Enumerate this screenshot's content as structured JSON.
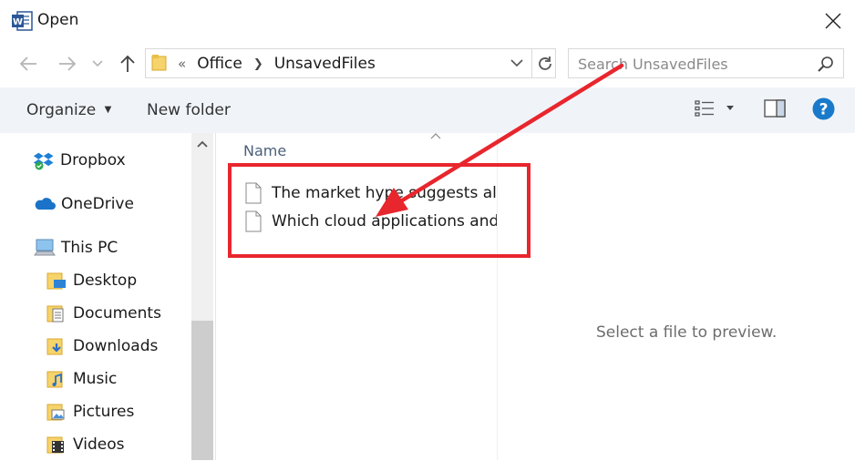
{
  "window": {
    "title": "Open"
  },
  "address": {
    "crumb_prefix": "«",
    "crumbs": [
      "Office",
      "UnsavedFiles"
    ]
  },
  "search": {
    "placeholder": "Search UnsavedFiles"
  },
  "toolbar": {
    "organize_label": "Organize",
    "new_folder_label": "New folder"
  },
  "sidebar": {
    "items": [
      {
        "label": "Dropbox",
        "icon": "dropbox-icon"
      },
      {
        "label": "OneDrive",
        "icon": "onedrive-icon"
      },
      {
        "label": "This PC",
        "icon": "computer-icon"
      },
      {
        "label": "Desktop",
        "icon": "desktop-folder-icon"
      },
      {
        "label": "Documents",
        "icon": "documents-folder-icon"
      },
      {
        "label": "Downloads",
        "icon": "downloads-folder-icon"
      },
      {
        "label": "Music",
        "icon": "music-folder-icon"
      },
      {
        "label": "Pictures",
        "icon": "pictures-folder-icon"
      },
      {
        "label": "Videos",
        "icon": "videos-folder-icon"
      }
    ]
  },
  "filelist": {
    "column_header": "Name",
    "files": [
      {
        "name": "The market hype suggests all M"
      },
      {
        "name": "Which cloud applications and S"
      }
    ]
  },
  "preview": {
    "message": "Select a file to preview."
  },
  "colors": {
    "accent": "#1979ca",
    "highlight": "#e8262d",
    "toolbar_bg": "#f0f4f9"
  }
}
